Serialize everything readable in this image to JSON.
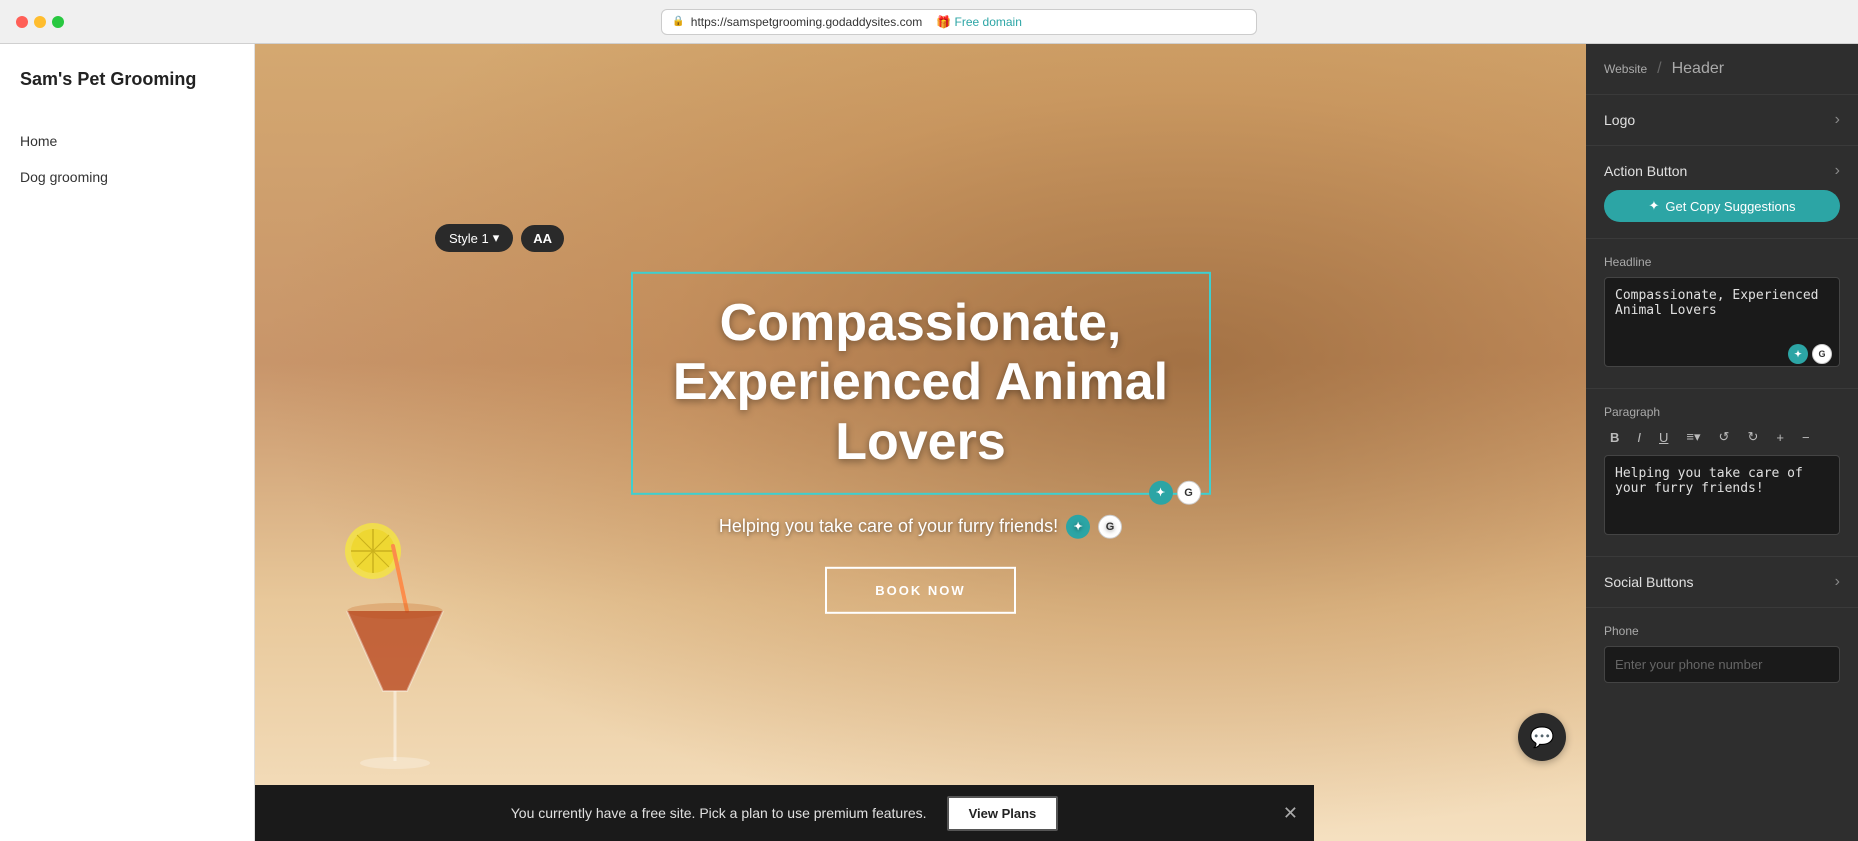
{
  "browser": {
    "url": "https://samspetgrooming.godaddysites.com",
    "free_domain_text": "Free domain"
  },
  "sidebar": {
    "site_title": "Sam's Pet Grooming",
    "nav_items": [
      {
        "label": "Home"
      },
      {
        "label": "Dog grooming"
      }
    ]
  },
  "hero": {
    "style_label": "Style 1",
    "aa_label": "AA",
    "headline": "Compassionate, Experienced Animal Lovers",
    "subtitle": "Helping you take care of your furry friends!",
    "book_now_label": "BOOK NOW"
  },
  "right_panel": {
    "breadcrumb_website": "Website",
    "breadcrumb_sep": "/",
    "breadcrumb_header": "Header",
    "logo_label": "Logo",
    "action_button_label": "Action Button",
    "get_copy_label": "Get Copy Suggestions",
    "headline_section_label": "Headline",
    "headline_value": "Compassionate, Experienced Animal Lovers",
    "paragraph_label": "Paragraph",
    "paragraph_value": "Helping you take care of your furry friends!",
    "social_buttons_label": "Social Buttons",
    "phone_label": "Phone",
    "phone_placeholder": "Enter your phone number",
    "formatting_buttons": [
      "B",
      "I",
      "U",
      "≡▾",
      "↺",
      "↻",
      "+",
      "−"
    ]
  },
  "banner": {
    "text": "You currently have a free site. Pick a plan to use premium features.",
    "view_plans_label": "View Plans"
  }
}
